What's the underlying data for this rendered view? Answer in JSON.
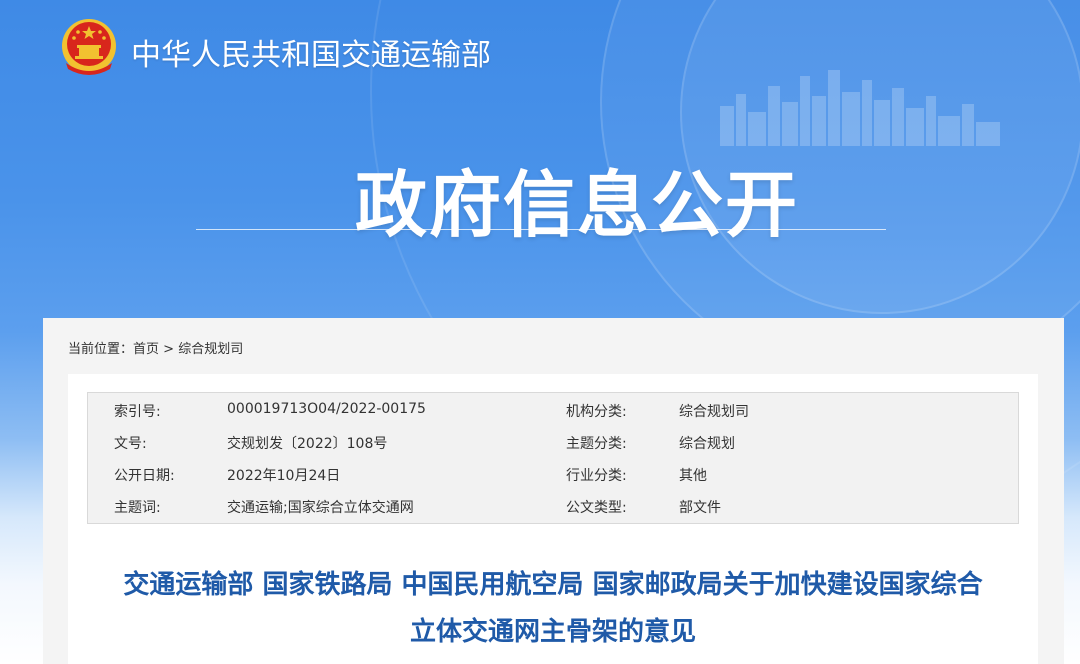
{
  "header": {
    "site_name": "中华人民共和国交通运输部",
    "section_title": "政府信息公开"
  },
  "breadcrumb": {
    "label": "当前位置：",
    "home": "首页",
    "separator": ">",
    "current": "综合规划司"
  },
  "metadata": {
    "rows": [
      {
        "key1": "索引号:",
        "val1": "000019713O04/2022-00175",
        "key2": "机构分类:",
        "val2": "综合规划司"
      },
      {
        "key1": "文号:",
        "val1": "交规划发〔2022〕108号",
        "key2": "主题分类:",
        "val2": "综合规划"
      },
      {
        "key1": "公开日期:",
        "val1": "2022年10月24日",
        "key2": "行业分类:",
        "val2": "其他"
      },
      {
        "key1": "主题词:",
        "val1": "交通运输;国家综合立体交通网",
        "key2": "公文类型:",
        "val2": "部文件"
      }
    ]
  },
  "article": {
    "title_line1": "交通运输部 国家铁路局 中国民用航空局 国家邮政局关于加快建设国家综合",
    "title_line2": "立体交通网主骨架的意见"
  },
  "colors": {
    "banner_blue": "#3f8ae6",
    "title_blue": "#1f5aa8",
    "emblem_red": "#d8261c",
    "emblem_gold": "#f2c230"
  },
  "icons": {
    "logo": "national-emblem-icon",
    "skyline": "city-skyline-icon"
  }
}
